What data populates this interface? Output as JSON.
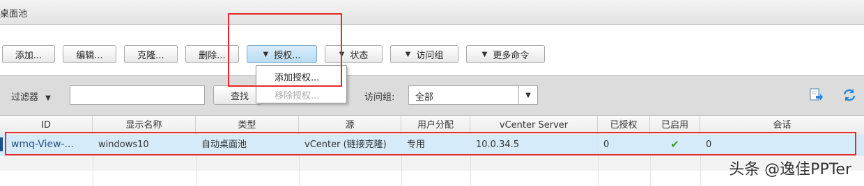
{
  "window": {
    "title": "桌面池"
  },
  "toolbar": {
    "add": "添加...",
    "edit": "编辑...",
    "clone": "克隆...",
    "delete": "删除...",
    "entitlements": "授权...",
    "status": "状态",
    "access_group": "访问组",
    "more_commands": "更多命令"
  },
  "entitlement_menu": {
    "add_entitlement": "添加授权...",
    "remove_entitlement": "移除授权..."
  },
  "filter": {
    "label": "过滤器",
    "input_value": "",
    "find_label": "查找",
    "access_group_label": "访问组:",
    "access_group_value": "全部"
  },
  "icons": {
    "export": "export-icon",
    "refresh": "refresh-icon"
  },
  "table": {
    "columns": [
      "ID",
      "显示名称",
      "类型",
      "源",
      "用户分配",
      "vCenter Server",
      "已授权",
      "已启用",
      "会话"
    ],
    "rows": [
      {
        "id": "wmq-View-...",
        "display_name": "windows10",
        "type": "自动桌面池",
        "source": "vCenter (链接克隆)",
        "user_assignment": "专用",
        "vcenter_server": "10.0.34.5",
        "entitled": "0",
        "enabled": "✔",
        "sessions": "0"
      }
    ]
  },
  "colors": {
    "highlight_border": "#e52828",
    "selected_row": "#d5ebfa",
    "check": "#3a9a2a"
  },
  "watermark": "头条 @逸佳PPTer"
}
